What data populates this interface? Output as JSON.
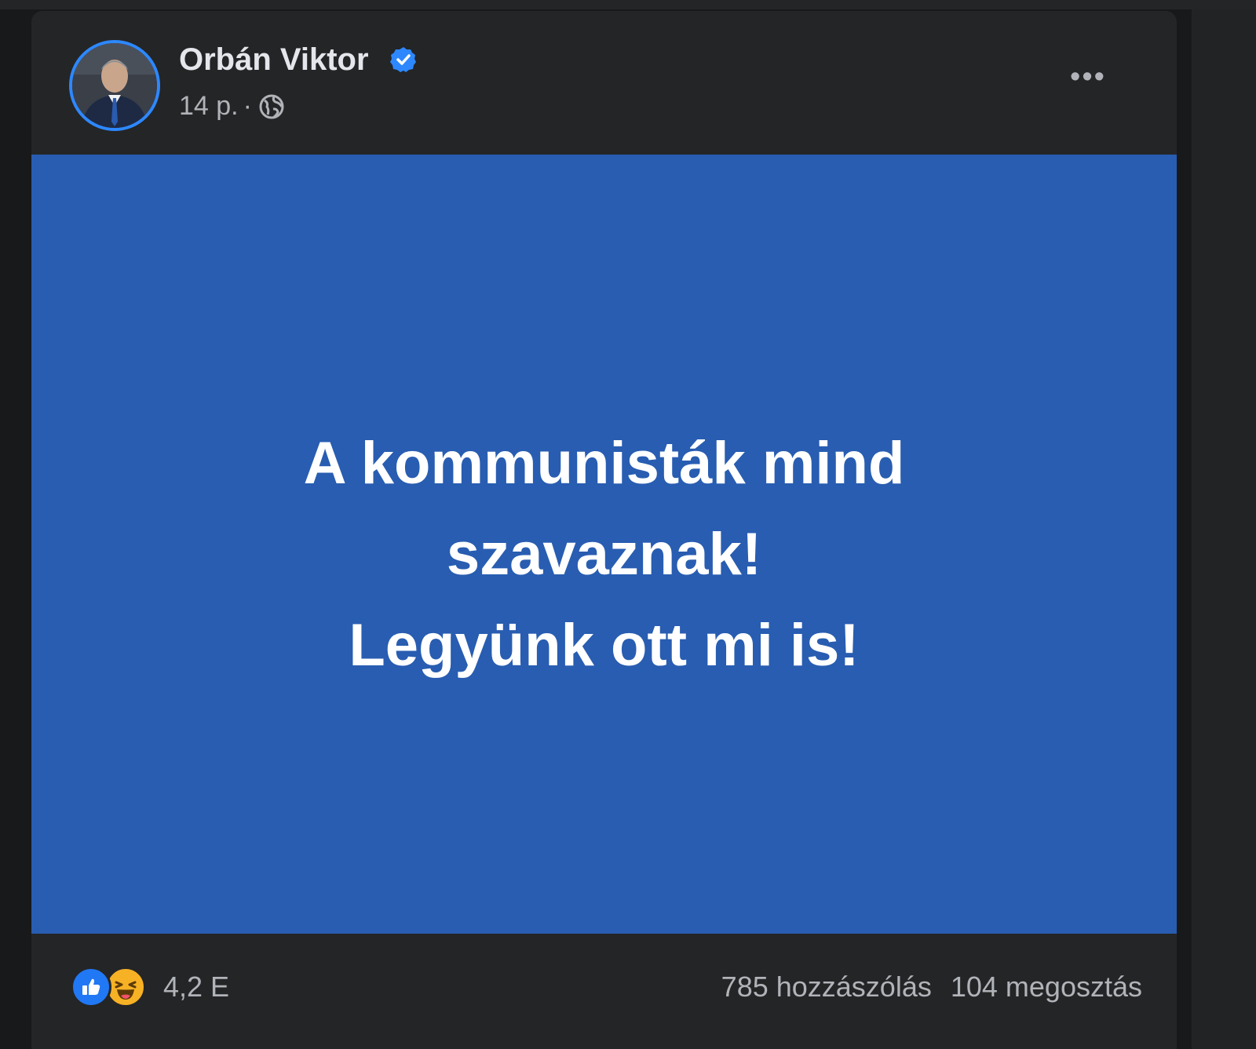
{
  "post": {
    "author": "Orbán Viktor",
    "time": "14 p.",
    "separator": "·",
    "more_label": "•••",
    "image_text": {
      "line1": "A kommunisták mind",
      "line2": "szavaznak!",
      "line3": "Legyünk ott mi is!"
    },
    "reactions_count": "4,2 E",
    "comments": "785 hozzászólás",
    "shares": "104 megosztás"
  },
  "colors": {
    "image_background": "#285db1",
    "card_background": "#242526",
    "page_background": "#18191a",
    "accent": "#2d88ff",
    "text_primary": "#e4e6eb",
    "text_secondary": "#b0b3b8"
  },
  "icons": {
    "verified": "verified-badge-icon",
    "audience": "globe-icon",
    "more": "more-options-icon",
    "like": "like-reaction-icon",
    "haha": "haha-reaction-icon"
  }
}
